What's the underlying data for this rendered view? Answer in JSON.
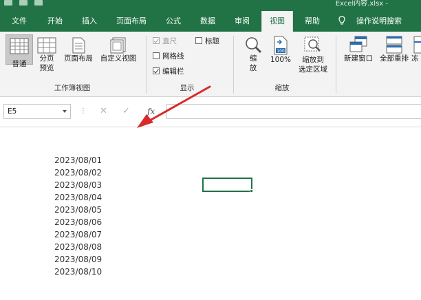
{
  "window": {
    "title": "Excel内容.xlsx -"
  },
  "tabs": [
    {
      "label": "文件"
    },
    {
      "label": "开始"
    },
    {
      "label": "插入"
    },
    {
      "label": "页面布局"
    },
    {
      "label": "公式"
    },
    {
      "label": "数据"
    },
    {
      "label": "审阅"
    },
    {
      "label": "视图",
      "active": true
    },
    {
      "label": "帮助"
    },
    {
      "label": "操作说明搜索"
    }
  ],
  "ribbon": {
    "workbook_views": {
      "label": "工作簿视图",
      "buttons": [
        {
          "label": "普通",
          "selected": true
        },
        {
          "label1": "分页",
          "label2": "预览"
        },
        {
          "label": "页面布局"
        },
        {
          "label": "自定义视图"
        }
      ]
    },
    "show": {
      "label": "显示",
      "checks": [
        {
          "label": "直尺",
          "checked": true,
          "disabled": true
        },
        {
          "label": "标题",
          "checked": false
        },
        {
          "label": "网格线",
          "checked": false
        },
        {
          "label": "编辑栏",
          "checked": true
        }
      ]
    },
    "zoom": {
      "label": "缩放",
      "buttons": [
        {
          "label1": "缩",
          "label2": "放"
        },
        {
          "label": "100%",
          "icon_text": "100"
        },
        {
          "label1": "缩放到",
          "label2": "选定区域"
        }
      ]
    },
    "window": {
      "buttons": [
        {
          "label": "新建窗口"
        },
        {
          "label": "全部重排"
        },
        {
          "label": "冻"
        }
      ]
    }
  },
  "formula_bar": {
    "name_box": "E5",
    "cancel_symbol": "✕",
    "enter_symbol": "✓",
    "fx_label": "fx",
    "value": ""
  },
  "sheet": {
    "cells": [
      "2023/08/01",
      "2023/08/02",
      "2023/08/03",
      "2023/08/04",
      "2023/08/05",
      "2023/08/06",
      "2023/08/07",
      "2023/08/08",
      "2023/08/09",
      "2023/08/10"
    ]
  },
  "colors": {
    "accent": "#217346",
    "annotation_arrow": "#d92b2b"
  }
}
